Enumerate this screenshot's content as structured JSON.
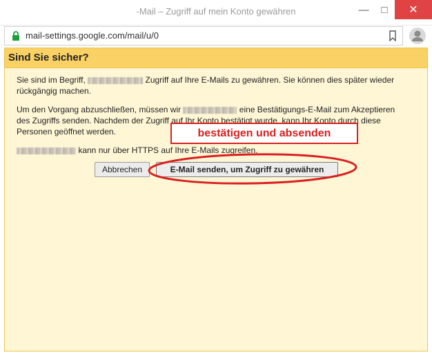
{
  "window": {
    "title": "-Mail – Zugriff auf mein Konto gewähren"
  },
  "browser": {
    "url": "mail-settings.google.com/mail/u/0"
  },
  "dialog": {
    "title": "Sind Sie sicher?",
    "para1_a": "Sie sind im Begriff, ",
    "para1_b": " Zugriff auf Ihre E-Mails zu gewähren. Sie können dies später wieder rückgängig machen.",
    "para2_a": "Um den Vorgang abzuschließen, müssen wir ",
    "para2_b": " eine Bestätigungs-E-Mail zum Akzeptieren des Zugriffs senden. Nachdem der Zugriff auf Ihr Konto bestätigt wurde, kann Ihr Konto durch diese Personen geöffnet werden.",
    "para3_b": " kann nur über HTTPS auf Ihre E-Mails zugreifen.",
    "cancel_label": "Abbrechen",
    "send_label": "E-Mail senden, um Zugriff zu gewähren"
  },
  "annotation": {
    "callout_text": "bestätigen und absenden",
    "color": "#d91f1f"
  },
  "colors": {
    "dialog_header": "#fad164",
    "dialog_body": "#fff6d6",
    "close_button": "#e04343"
  },
  "icons": {
    "lock": "lock-icon",
    "bookmark": "bookmark-icon",
    "profile": "profile-icon"
  }
}
